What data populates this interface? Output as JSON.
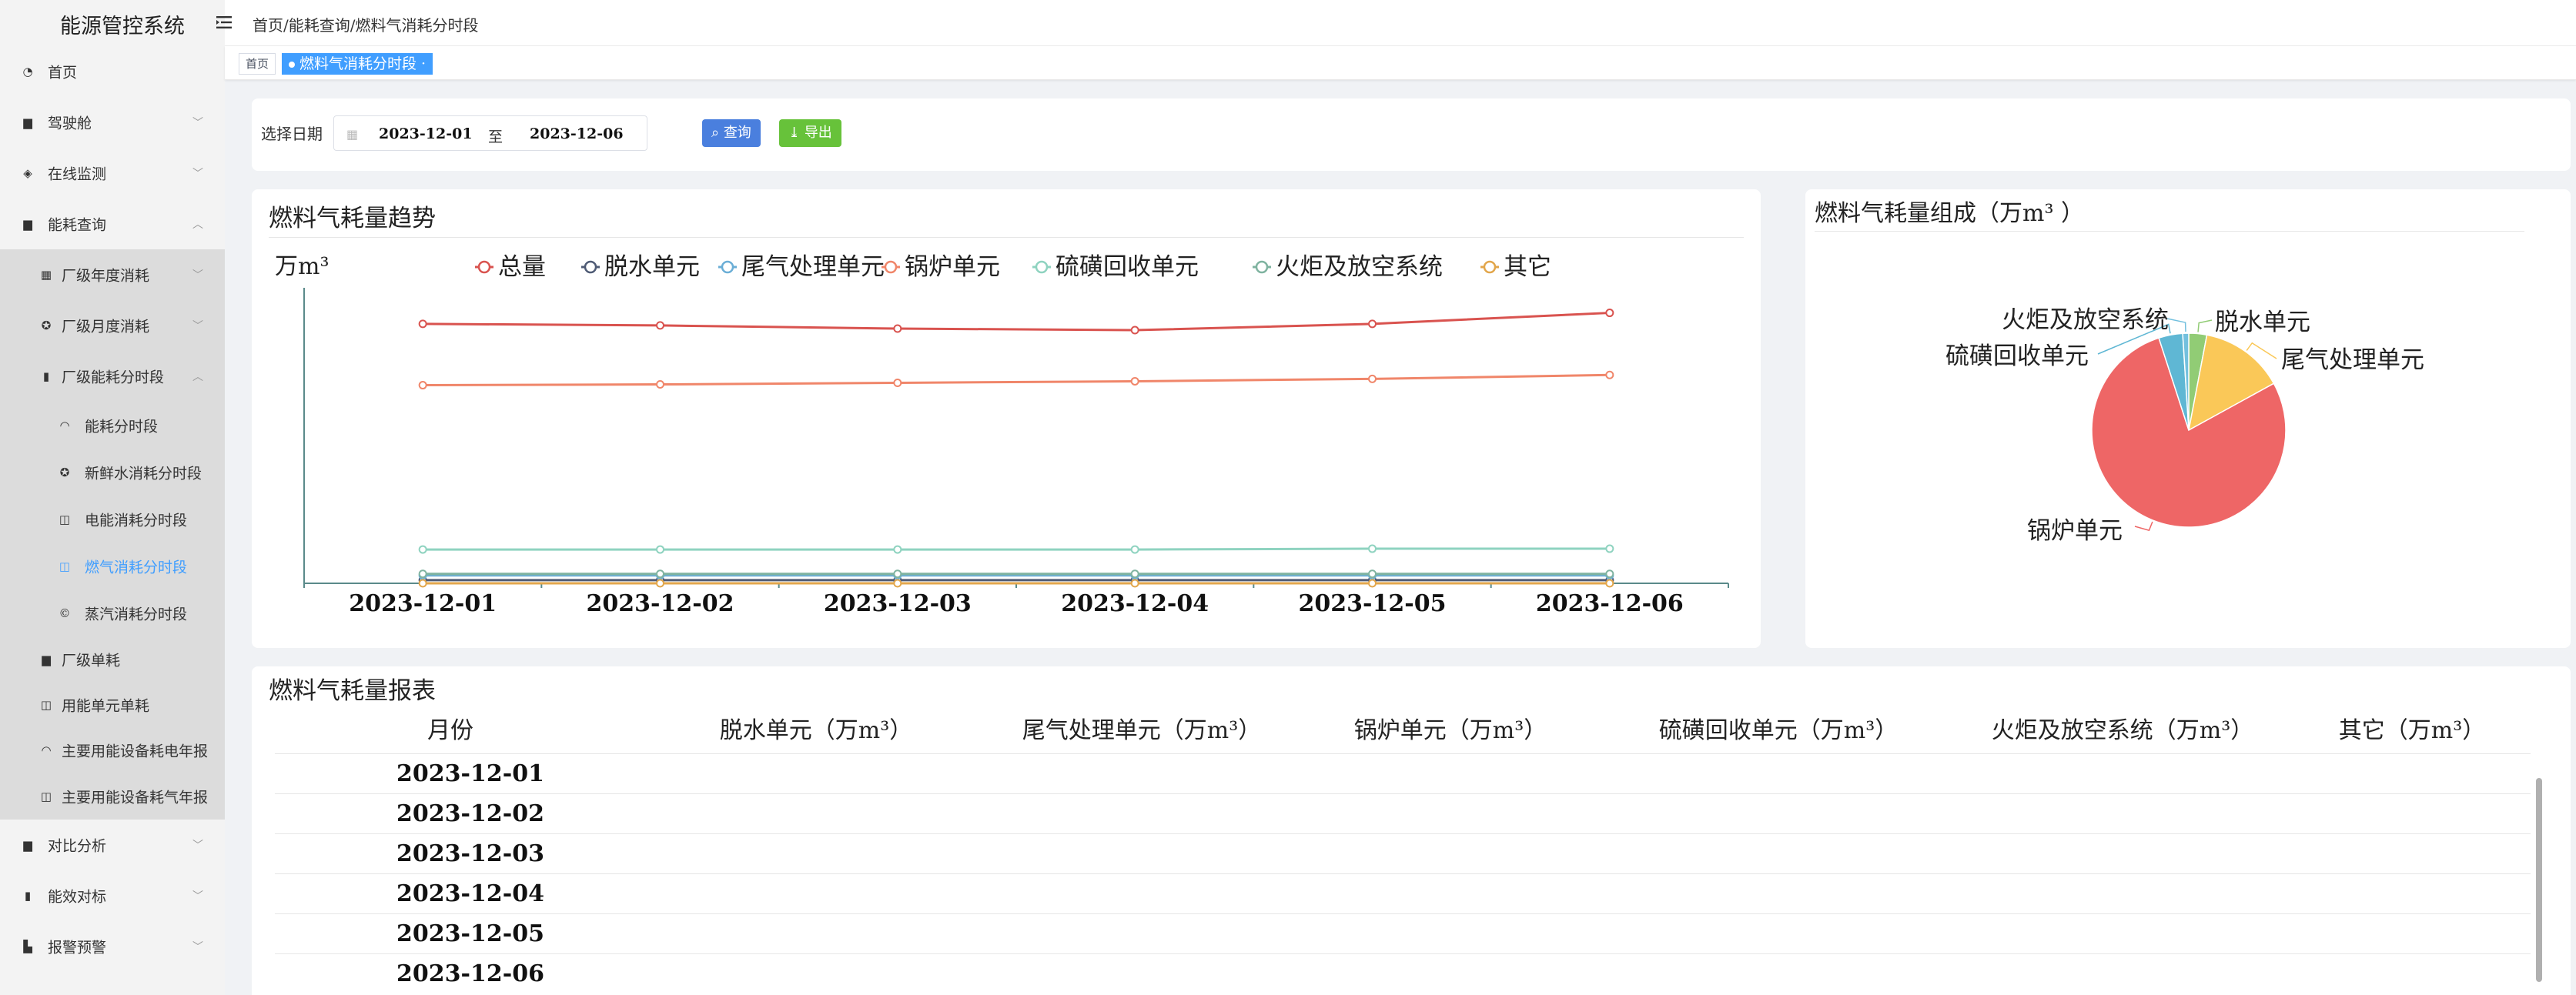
{
  "app": {
    "title": "能源管控系统"
  },
  "breadcrumb": "首页/能耗查询/燃料气消耗分时段",
  "sidebar": {
    "items": [
      {
        "label": "首页",
        "icon": "dashboard-icon"
      },
      {
        "label": "驾驶舱",
        "icon": "cockpit-icon"
      },
      {
        "label": "在线监测",
        "icon": "monitor-icon"
      },
      {
        "label": "能耗查询",
        "icon": "energy-icon"
      }
    ],
    "sub": [
      {
        "label": "厂级年度消耗",
        "icon": "grid-icon"
      },
      {
        "label": "厂级月度消耗",
        "icon": "gear-icon"
      },
      {
        "label": "厂级能耗分时段",
        "icon": "bar-icon"
      }
    ],
    "sub3": [
      {
        "label": "能耗分时段",
        "icon": "gauge-icon"
      },
      {
        "label": "新鲜水消耗分时段",
        "icon": "gear-icon"
      },
      {
        "label": "电能消耗分时段",
        "icon": "table-icon"
      },
      {
        "label": "燃气消耗分时段",
        "icon": "table-icon"
      },
      {
        "label": "蒸汽消耗分时段",
        "icon": "steam-icon"
      }
    ],
    "sub_after": [
      {
        "label": "厂级单耗",
        "icon": "doc-icon"
      },
      {
        "label": "用能单元单耗",
        "icon": "table-icon"
      },
      {
        "label": "主要用能设备耗电年报",
        "icon": "gauge-icon"
      },
      {
        "label": "主要用能设备耗气年报",
        "icon": "table-icon"
      }
    ],
    "bottom": [
      {
        "label": "对比分析",
        "icon": "compare-icon"
      },
      {
        "label": "能效对标",
        "icon": "chart-icon"
      },
      {
        "label": "报警预警",
        "icon": "alarm-icon"
      }
    ]
  },
  "tags": {
    "home": "首页",
    "current": "燃料气消耗分时段"
  },
  "filter": {
    "label": "选择日期",
    "start": "2023-12-01",
    "sep": "至",
    "end": "2023-12-06",
    "query": "查询",
    "export": "导出"
  },
  "trend": {
    "title": "燃料气耗量趋势",
    "unit": "万m³"
  },
  "pie": {
    "title": "燃料气耗量组成（万m³ ）"
  },
  "colors": {
    "total": "#d9534f",
    "dehydration": "#4f5b75",
    "tailgas": "#6baed6",
    "boiler": "#f0866a",
    "sulfur": "#8fd3c0",
    "flare": "#7fb3a0",
    "other": "#e2a64b",
    "pie_boiler": "#ee6666",
    "pie_tailgas": "#fac858",
    "pie_dehydration": "#91cc75",
    "pie_sulfur": "#5fb7d4",
    "pie_flare": "#73c0de",
    "axis": "#5a8a8a",
    "primary": "#409eff"
  },
  "chart_data": [
    {
      "type": "line",
      "title": "燃料气耗量趋势",
      "ylabel": "万m³",
      "categories": [
        "2023-12-01",
        "2023-12-02",
        "2023-12-03",
        "2023-12-04",
        "2023-12-05",
        "2023-12-06"
      ],
      "ylim": [
        0,
        3.7
      ],
      "legend_position": "top",
      "series": [
        {
          "name": "总量",
          "values": [
            3.3,
            3.28,
            3.24,
            3.22,
            3.3,
            3.44
          ]
        },
        {
          "name": "脱水单元",
          "values": [
            0.04,
            0.04,
            0.04,
            0.04,
            0.04,
            0.04
          ]
        },
        {
          "name": "尾气处理单元",
          "values": [
            0.1,
            0.1,
            0.1,
            0.1,
            0.1,
            0.1
          ]
        },
        {
          "name": "锅炉单元",
          "values": [
            2.52,
            2.53,
            2.55,
            2.57,
            2.6,
            2.65
          ]
        },
        {
          "name": "硫磺回收单元",
          "values": [
            0.43,
            0.43,
            0.43,
            0.43,
            0.44,
            0.44
          ]
        },
        {
          "name": "火炬及放空系统",
          "values": [
            0.12,
            0.12,
            0.12,
            0.12,
            0.12,
            0.12
          ]
        },
        {
          "name": "其它",
          "values": [
            0.0,
            0.0,
            0.0,
            0.0,
            0.0,
            0.0
          ]
        }
      ]
    },
    {
      "type": "pie",
      "title": "燃料气耗量组成（万m³ ）",
      "slices": [
        {
          "name": "锅炉单元",
          "value": 78
        },
        {
          "name": "尾气处理单元",
          "value": 14
        },
        {
          "name": "脱水单元",
          "value": 3
        },
        {
          "name": "火炬及放空系统",
          "value": 1
        },
        {
          "name": "硫磺回收单元",
          "value": 4
        }
      ]
    }
  ],
  "table": {
    "title": "燃料气耗量报表",
    "headers": [
      "月份",
      "脱水单元（万m³）",
      "尾气处理单元（万m³）",
      "锅炉单元（万m³）",
      "硫磺回收单元（万m³）",
      "火炬及放空系统（万m³）",
      "其它（万m³）"
    ],
    "rows": [
      "2023-12-01",
      "2023-12-02",
      "2023-12-03",
      "2023-12-04",
      "2023-12-05",
      "2023-12-06"
    ]
  }
}
